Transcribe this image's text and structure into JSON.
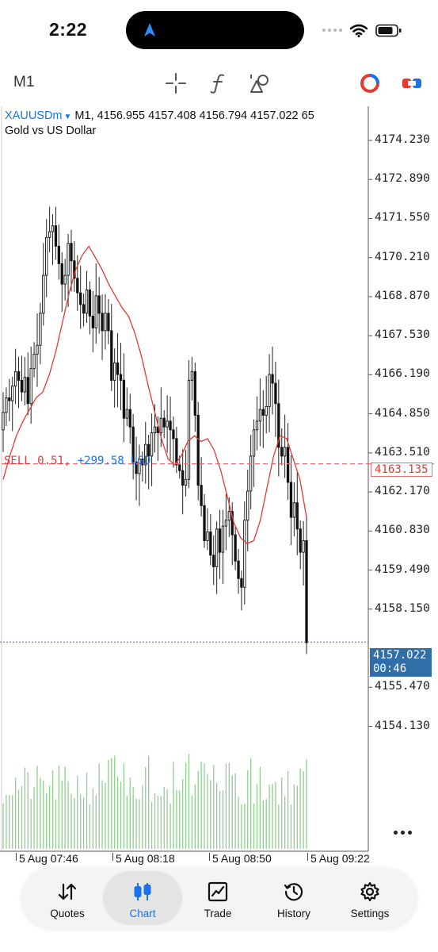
{
  "status_bar": {
    "time": "2:22"
  },
  "toolbar": {
    "timeframe": "M1"
  },
  "symbol": {
    "name": "XAUUSDm",
    "timeframe": "M1,",
    "ohlc": "4156.955 4157.408 4156.794 4157.022 65",
    "description": "Gold vs US Dollar"
  },
  "position": {
    "type_lots": "SELL 0.51,",
    "profit": "+299.58 USD",
    "open_price": "4163.135"
  },
  "current_price": {
    "price": "4157.022",
    "countdown": "00:46"
  },
  "price_scale": [
    "4174.230",
    "4172.890",
    "4171.550",
    "4170.210",
    "4168.870",
    "4167.530",
    "4166.190",
    "4164.850",
    "4163.510",
    "4162.170",
    "4160.830",
    "4159.490",
    "4158.150",
    "4155.470",
    "4154.130"
  ],
  "time_scale": [
    "5 Aug 07:46",
    "5 Aug 08:18",
    "5 Aug 08:50",
    "5 Aug 09:22"
  ],
  "nav": {
    "quotes": "Quotes",
    "chart": "Chart",
    "trade": "Trade",
    "history": "History",
    "settings": "Settings"
  },
  "colors": {
    "accent": "#1a73e8",
    "sell_line": "#e53935",
    "moving_average": "#e53935",
    "volume": "#8fce8f",
    "current_price_bg": "#2f6ea8"
  },
  "icons": [
    "navigation-arrow-icon",
    "wifi-icon",
    "battery-icon",
    "crosshair-icon",
    "indicator-f-icon",
    "objects-icon",
    "one-click-trading-icon",
    "trade-levels-icon",
    "quotes-arrows-icon",
    "candlestick-icon",
    "trade-chart-icon",
    "history-clock-icon",
    "settings-gear-icon"
  ],
  "chart_data": {
    "type": "candlestick",
    "symbol": "XAUUSDm",
    "timeframe": "M1",
    "ylim": [
      4153.3,
      4175.4
    ],
    "yticks": [
      4174.23,
      4172.89,
      4171.55,
      4170.21,
      4168.87,
      4167.53,
      4166.19,
      4164.85,
      4163.51,
      4162.17,
      4160.83,
      4159.49,
      4158.15,
      4155.47,
      4154.13
    ],
    "xticks": [
      "5 Aug 07:46",
      "5 Aug 08:18",
      "5 Aug 08:50",
      "5 Aug 09:22"
    ],
    "sell_level": 4163.135,
    "current_price": 4157.022,
    "close": [
      4164.9,
      4165.4,
      4165.3,
      4165.8,
      4166.3,
      4166.0,
      4165.6,
      4166.1,
      4165.2,
      4166.4,
      4166.9,
      4167.2,
      4168.3,
      4169.6,
      4170.9,
      4171.1,
      4171.3,
      4170.6,
      4170.0,
      4169.3,
      4169.6,
      4170.7,
      4170.1,
      4169.5,
      4169.0,
      4168.6,
      4168.3,
      4169.1,
      4168.2,
      4167.8,
      4168.9,
      4168.3,
      4167.7,
      4168.3,
      4167.7,
      4166.0,
      4166.6,
      4166.2,
      4166.0,
      4164.7,
      4165.0,
      4164.4,
      4163.2,
      4162.8,
      4163.3,
      4163.1,
      4163.8,
      4163.4,
      4164.2,
      4164.4,
      4164.2,
      4164.7,
      4164.4,
      4164.6,
      4164.3,
      4164.0,
      4163.1,
      4162.9,
      4162.4,
      4162.6,
      4166.0,
      4166.3,
      4164.8,
      4162.4,
      4161.7,
      4160.5,
      4160.8,
      4160.0,
      4159.6,
      4160.9,
      4160.1,
      4161.0,
      4161.2,
      4161.5,
      4160.7,
      4159.8,
      4159.2,
      4158.9,
      4161.2,
      4162.2,
      4163.4,
      4164.3,
      4164.6,
      4165.0,
      4164.8,
      4165.1,
      4166.2,
      4165.9,
      4165.2,
      4163.7,
      4163.4,
      4163.7,
      4162.5,
      4161.3,
      4161.8,
      4160.9,
      4160.1,
      4160.5,
      4157.0
    ],
    "moving_average": [
      4162.6,
      4163.4,
      4164.1,
      4164.6,
      4165.0,
      4165.4,
      4165.6,
      4166.2,
      4167.0,
      4168.0,
      4169.0,
      4169.8,
      4170.3,
      4170.6,
      4170.2,
      4169.8,
      4169.3,
      4168.9,
      4168.5,
      4168.2,
      4167.6,
      4166.8,
      4165.8,
      4164.9,
      4164.0,
      4163.3,
      4163.1,
      4163.4,
      4163.9,
      4164.1,
      4163.9,
      4164.0,
      4163.6,
      4162.9,
      4162.0,
      4161.1,
      4160.6,
      4160.4,
      4160.5,
      4161.2,
      4162.3,
      4163.4,
      4164.1,
      4164.0,
      4163.3,
      4162.6,
      4161.3
    ],
    "volume_note": "per-bar tick volume histogram (green) in lower pane"
  }
}
